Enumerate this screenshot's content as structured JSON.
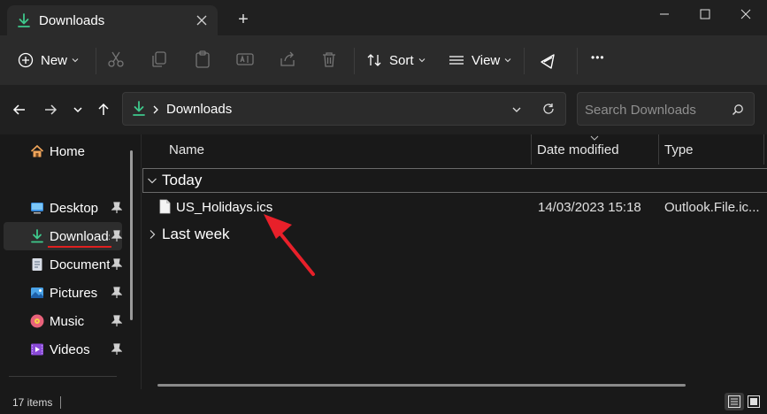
{
  "window": {
    "tab_title": "Downloads",
    "new_tab_label": "+"
  },
  "toolbar": {
    "new_label": "New",
    "sort_label": "Sort",
    "view_label": "View",
    "more_label": "•••"
  },
  "address": {
    "breadcrumb": "Downloads",
    "search_placeholder": "Search Downloads"
  },
  "sidebar": {
    "items": [
      {
        "label": "Home",
        "icon": "home-icon",
        "pinned": false
      },
      {
        "label": "Desktop",
        "icon": "desktop-icon",
        "pinned": true
      },
      {
        "label": "Downloads",
        "icon": "download-icon",
        "pinned": true,
        "selected": true
      },
      {
        "label": "Documents",
        "icon": "documents-icon",
        "pinned": true
      },
      {
        "label": "Pictures",
        "icon": "pictures-icon",
        "pinned": true
      },
      {
        "label": "Music",
        "icon": "music-icon",
        "pinned": true
      },
      {
        "label": "Videos",
        "icon": "videos-icon",
        "pinned": true
      }
    ]
  },
  "filelist": {
    "columns": [
      "Name",
      "Date modified",
      "Type"
    ],
    "groups": [
      {
        "label": "Today",
        "expanded": true,
        "files": [
          {
            "name": "US_Holidays.ics",
            "date": "14/03/2023 15:18",
            "type": "Outlook.File.ic..."
          }
        ]
      },
      {
        "label": "Last week",
        "expanded": false,
        "files": []
      }
    ]
  },
  "status": {
    "item_count": "17 items"
  },
  "colors": {
    "accent": "#3ec98c",
    "annotation_arrow": "#e8202a",
    "underline": "#e02020"
  }
}
